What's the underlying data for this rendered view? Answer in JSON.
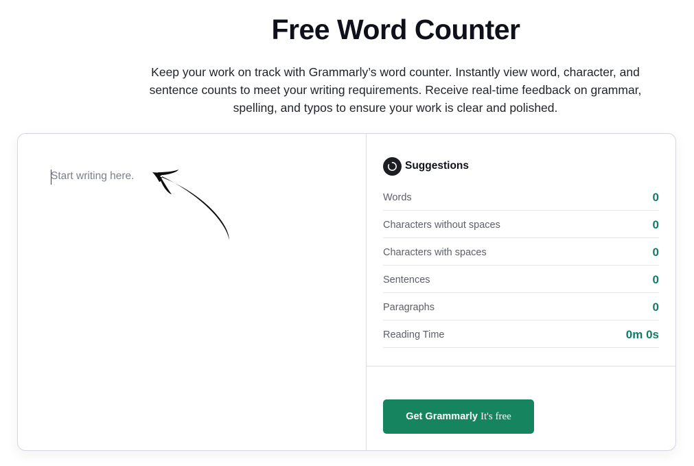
{
  "header": {
    "title": "Free Word Counter",
    "subtitle": "Keep your work on track with Grammarly’s word counter. Instantly view word, character, and sentence counts to meet your writing requirements. Receive real-time feedback on grammar, spelling, and typos to ensure your work is clear and polished."
  },
  "editor": {
    "placeholder": "Start writing here."
  },
  "panel": {
    "suggestions_label": "Suggestions",
    "icons": {
      "suggestions": "spinner-icon",
      "hint": "curved-arrow-icon"
    },
    "stats": [
      {
        "label": "Words",
        "value": "0"
      },
      {
        "label": "Characters without spaces",
        "value": "0"
      },
      {
        "label": "Characters with spaces",
        "value": "0"
      },
      {
        "label": "Sentences",
        "value": "0"
      },
      {
        "label": "Paragraphs",
        "value": "0"
      },
      {
        "label": "Reading Time",
        "value": "0m 0s"
      }
    ],
    "cta": {
      "strong": "Get Grammarly",
      "light": "It's free"
    }
  },
  "colors": {
    "accent_green": "#15845f",
    "value_green": "#0f7d64",
    "text_dark": "#0e101a"
  }
}
